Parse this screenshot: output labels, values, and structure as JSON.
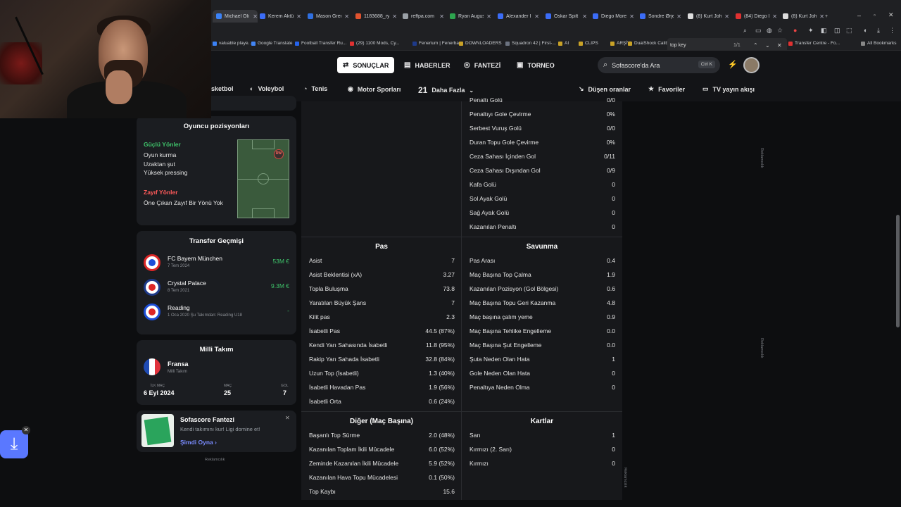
{
  "browser": {
    "tabs": [
      {
        "title": "Michael Oli",
        "color": "#3b82f6",
        "active": true
      },
      {
        "title": "Kerem Aktü",
        "color": "#3b6cf6"
      },
      {
        "title": "Mason Gree",
        "color": "#2f6fe0"
      },
      {
        "title": "1183688_ry",
        "color": "#e0532f"
      },
      {
        "title": "reffpa.com",
        "color": "#9aa0a6"
      },
      {
        "title": "Ryan Augus",
        "color": "#2da44e"
      },
      {
        "title": "Alexander I",
        "color": "#3b6cf6"
      },
      {
        "title": "Oskar Spilt",
        "color": "#3b6cf6"
      },
      {
        "title": "Diego More",
        "color": "#3b6cf6"
      },
      {
        "title": "Sondre Ørje",
        "color": "#3b6cf6"
      },
      {
        "title": "(8) Kurt Joh",
        "color": "#dddddd"
      },
      {
        "title": "(84) Diego I",
        "color": "#e03131"
      },
      {
        "title": "(8) Kurt Joh",
        "color": "#dddddd"
      }
    ],
    "new_tab": "+",
    "find_bar": {
      "query": "top key",
      "count": "1/1"
    },
    "bookmarks": [
      "valuable playe...",
      "Google Translate",
      "Football Transfer Ru...",
      "(29) 1100 Mods, Cy...",
      "Fenerium | Fenerba...",
      "DOWNLOADERS",
      "Squadron 42 | First-...",
      "AI",
      "CLIPS",
      "ARŞİV",
      "DualShock Calib",
      "Transfer Centre - Fo..."
    ],
    "all_bookmarks": "All Bookmarks"
  },
  "header": {
    "nav": [
      {
        "label": "SONUÇLAR",
        "icon": "⇄",
        "active": true
      },
      {
        "label": "HABERLER",
        "icon": "▤"
      },
      {
        "label": "FANTEZİ",
        "icon": "◎"
      },
      {
        "label": "TORNEO",
        "icon": "▣"
      }
    ],
    "search": {
      "placeholder": "Sofascore'da Ara",
      "shortcut": "Ctrl K"
    },
    "subnav": [
      {
        "label": "sketbol",
        "icon": ""
      },
      {
        "label": "Voleybol",
        "icon": "◐"
      },
      {
        "label": "Tenis",
        "icon": "◔"
      },
      {
        "label": "Motor Sporları",
        "icon": "◉"
      },
      {
        "label": "Daha Fazla",
        "icon": "21"
      }
    ],
    "right_nav": [
      {
        "label": "Düşen oranlar",
        "icon": "↘"
      },
      {
        "label": "Favoriler",
        "icon": "★"
      },
      {
        "label": "TV yayın akışı",
        "icon": "▭"
      }
    ]
  },
  "positions": {
    "title": "Oyuncu pozisyonları",
    "strengths_title": "Güçlü Yönler",
    "strengths": [
      "Oyun kurma",
      "Uzaktan şut",
      "Yüksek pressing"
    ],
    "weaknesses_title": "Zayıf Yönler",
    "weaknesses": [
      "Öne Çıkan Zayıf Bir Yönü Yok"
    ],
    "position_badge": "RW"
  },
  "transfers": {
    "title": "Transfer Geçmişi",
    "items": [
      {
        "club": "FC Bayern München",
        "date": "7 Tem 2024",
        "fee": "53M €"
      },
      {
        "club": "Crystal Palace",
        "date": "8 Tem 2021",
        "fee": "9.3M €"
      },
      {
        "club": "Reading",
        "date": "1 Oca 2020 Şu Takımdan: Reading U18",
        "fee": "-"
      }
    ]
  },
  "national": {
    "title": "Milli Takım",
    "team": "Fransa",
    "sub": "Milli Takım",
    "debut_label": "İLK MAÇ",
    "debut": "6 Eyl 2024",
    "matches_label": "MAÇ",
    "matches": "25",
    "goals_label": "GOL",
    "goals": "7"
  },
  "fantasy": {
    "title": "Sofascore Fantezi",
    "text": "Kendi takımını kur! Ligi domine et!",
    "cta": "Şimdi Oyna",
    "ad_label": "Reklamcılık"
  },
  "stats": {
    "top_right": [
      {
        "label": "Penaltı Golü",
        "value": "0/0"
      },
      {
        "label": "Penaltıyı Gole Çevirme",
        "value": "0%"
      },
      {
        "label": "Serbest Vuruş Golü",
        "value": "0/0"
      },
      {
        "label": "Duran Topu Gole Çevirme",
        "value": "0%"
      },
      {
        "label": "Ceza Sahası İçinden Gol",
        "value": "0/11"
      },
      {
        "label": "Ceza Sahası Dışından Gol",
        "value": "0/9"
      },
      {
        "label": "Kafa Golü",
        "value": "0"
      },
      {
        "label": "Sol Ayak Golü",
        "value": "0"
      },
      {
        "label": "Sağ Ayak Golü",
        "value": "0"
      },
      {
        "label": "Kazanılan Penaltı",
        "value": "0"
      }
    ],
    "pass_title": "Pas",
    "pass": [
      {
        "label": "Asist",
        "value": "7"
      },
      {
        "label": "Asist Beklentisi (xA)",
        "value": "3.27"
      },
      {
        "label": "Topla Buluşma",
        "value": "73.8"
      },
      {
        "label": "Yaratılan Büyük Şans",
        "value": "7"
      },
      {
        "label": "Kilit pas",
        "value": "2.3"
      },
      {
        "label": "İsabetli Pas",
        "value": "44.5 (87%)"
      },
      {
        "label": "Kendi Yarı Sahasında İsabetli",
        "value": "11.8 (95%)"
      },
      {
        "label": "Rakip Yarı Sahada İsabetli",
        "value": "32.8 (84%)"
      },
      {
        "label": "Uzun Top (İsabetli)",
        "value": "1.3 (40%)"
      },
      {
        "label": "İsabetli Havadan Pas",
        "value": "1.9 (56%)"
      },
      {
        "label": "İsabetli Orta",
        "value": "0.6 (24%)"
      }
    ],
    "defense_title": "Savunma",
    "defense": [
      {
        "label": "Pas Arası",
        "value": "0.4"
      },
      {
        "label": "Maç Başına Top Çalma",
        "value": "1.9"
      },
      {
        "label": "Kazanılan Pozisyon (Gol Bölgesi)",
        "value": "0.6"
      },
      {
        "label": "Maç Başına Topu Geri Kazanma",
        "value": "4.8"
      },
      {
        "label": "Maç başına çalım yeme",
        "value": "0.9"
      },
      {
        "label": "Maç Başına Tehlike Engelleme",
        "value": "0.0"
      },
      {
        "label": "Maç Başına Şut Engelleme",
        "value": "0.0"
      },
      {
        "label": "Şuta Neden Olan Hata",
        "value": "1"
      },
      {
        "label": "Gole Neden Olan Hata",
        "value": "0"
      },
      {
        "label": "Penaltıya Neden Olma",
        "value": "0"
      }
    ],
    "other_title": "Diğer (Maç Başına)",
    "other": [
      {
        "label": "Başarılı Top Sürme",
        "value": "2.0 (48%)"
      },
      {
        "label": "Kazanılan Toplam İkili Mücadele",
        "value": "6.0 (52%)"
      },
      {
        "label": "Zeminde Kazanılan İkili Mücadele",
        "value": "5.9 (52%)"
      },
      {
        "label": "Kazanılan Hava Topu Mücadelesi",
        "value": "0.1 (50%)"
      },
      {
        "label": "Top Kaybı",
        "value": "15.6"
      }
    ],
    "cards_title": "Kartlar",
    "cards": [
      {
        "label": "Sarı",
        "value": "1"
      },
      {
        "label": "Kırmızı (2. Sarı)",
        "value": "0"
      },
      {
        "label": "Kırmızı",
        "value": "0"
      }
    ]
  },
  "ads": {
    "label": "Reklamcılık"
  }
}
